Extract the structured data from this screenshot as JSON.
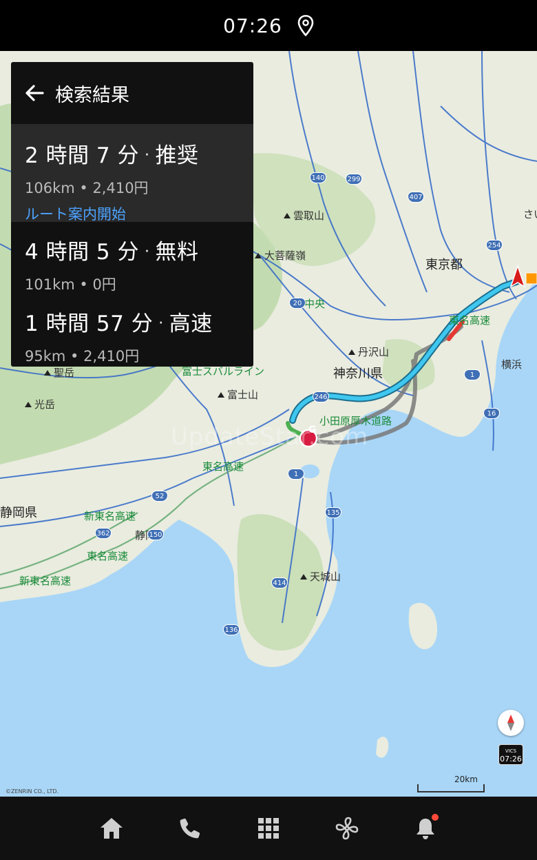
{
  "status_bar": {
    "time": "07:26",
    "location_icon": "location-pin-icon"
  },
  "panel": {
    "back_icon": "arrow-left-icon",
    "title": "検索結果",
    "routes": [
      {
        "duration": "2 時間 7 分",
        "separator": "·",
        "type": "推奨",
        "meta": "106km • 2,410円",
        "action": "ルート案内開始"
      },
      {
        "duration": "4 時間 5 分",
        "separator": "·",
        "type": "無料",
        "meta": "101km • 0円"
      },
      {
        "duration": "1 時間 57 分",
        "separator": "·",
        "type": "高速",
        "meta": "95km • 2,410円"
      }
    ]
  },
  "map": {
    "prefectures": {
      "tokyo": "東京都",
      "kanagawa": "神奈川県",
      "shizuoka": "静岡県"
    },
    "places": {
      "saitama": "さいた",
      "yokohama": "横浜",
      "shizuoka_city": "静岡"
    },
    "mountains": {
      "kumotori": "雲取山",
      "daibosatsu": "大菩薩嶺",
      "tanzawa": "丹沢山",
      "fuji": "富士山",
      "amagi": "天城山",
      "ikari": "聖岳",
      "kouji": "光岳"
    },
    "roads": {
      "chuo": "中央",
      "tomei_east": "東名高速",
      "odawara": "小田原厚木道路",
      "fuji_subaru": "富士スバルライン",
      "tomei_west": "東名高速",
      "shintomei_1": "新東名高速",
      "tomei_sw": "東名高速",
      "shintomei_2": "新東名高速"
    },
    "shields": [
      "140",
      "299",
      "407",
      "254",
      "20",
      "246",
      "1",
      "52",
      "362",
      "150",
      "135",
      "414",
      "136",
      "1",
      "16"
    ],
    "watermark": "UpdateStar.com",
    "goal_marker": "G",
    "compass_icon": "compass-icon",
    "vics_label": "VICS",
    "vics_time": "07:26",
    "scale": "20km",
    "copyright": "©ZENRIN CO., LTD."
  },
  "nav": [
    {
      "name": "home",
      "icon": "home-icon"
    },
    {
      "name": "phone",
      "icon": "phone-icon"
    },
    {
      "name": "apps",
      "icon": "grid-icon"
    },
    {
      "name": "climate",
      "icon": "fan-icon"
    },
    {
      "name": "notifications",
      "icon": "bell-icon"
    }
  ],
  "colors": {
    "route_main": "#3fc7ef",
    "route_alt": "#8a8a8a",
    "traffic": "#e53935",
    "goal": "#d81b40",
    "link": "#4da3ff",
    "water": "#a9d6f7",
    "land": "#e9ecdf",
    "forest": "#bcd8a8"
  }
}
